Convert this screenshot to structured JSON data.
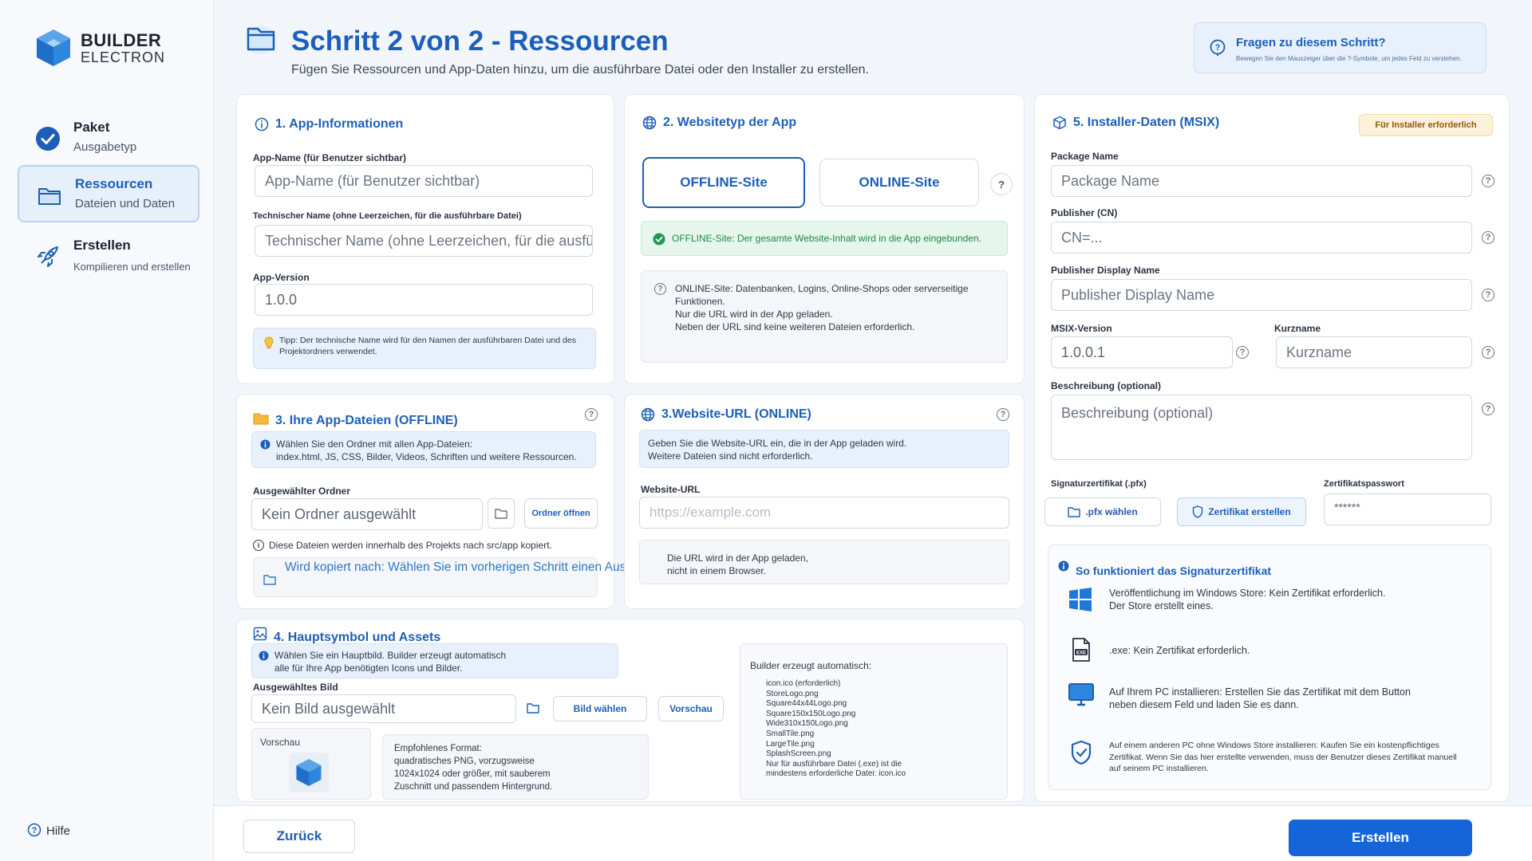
{
  "sidebar": {
    "logo_line1": "BUILDER",
    "logo_line2": "ELECTRON",
    "steps": [
      {
        "title": "Paket",
        "subtitle": "Ausgabetyp",
        "icon": "check-circle-icon",
        "state": "done"
      },
      {
        "title": "Ressourcen",
        "subtitle": "Dateien und Daten",
        "icon": "folder-icon",
        "state": "active"
      },
      {
        "title": "Erstellen",
        "subtitle": "Kompilieren und erstellen",
        "icon": "rocket-icon",
        "state": "pending"
      }
    ],
    "help_label": "Hilfe"
  },
  "header": {
    "title": "Schritt 2 von 2 - Ressourcen",
    "subtitle": "Fügen Sie Ressourcen und App-Daten hinzu, um die ausführbare Datei oder den Installer zu erstellen.",
    "help_title": "Fragen zu diesem Schritt?",
    "help_text": "Bewegen Sie den Mauszeiger über die ?-Symbole, um jedes Feld zu verstehen."
  },
  "app_info": {
    "title": "1. App-Informationen",
    "name_label": "App-Name (für Benutzer sichtbar)",
    "name_placeholder": "App-Name (für Benutzer sichtbar)",
    "tech_label": "Technischer Name (ohne Leerzeichen, für die ausführbare Datei)",
    "tech_placeholder": "Technischer Name (ohne Leerzeichen, für die ausführbare Datei)",
    "version_label": "App-Version",
    "version_value": "1.0.0",
    "tip": "Tipp: Der technische Name wird für den Namen der ausführbaren Datei und des Projektordners verwendet."
  },
  "site_type": {
    "title": "2. Websitetyp der App",
    "offline_label": "OFFLINE-Site",
    "online_label": "ONLINE-Site",
    "help_glyph": "?",
    "offline_note": "OFFLINE-Site: Der gesamte Website-Inhalt wird in die App eingebunden.",
    "online_note_1": "ONLINE-Site: Datenbanken, Logins, Online-Shops oder serverseitige Funktionen.",
    "online_note_2": "Nur die URL wird in der App geladen.",
    "online_note_3": "Neben der URL sind keine weiteren Dateien erforderlich."
  },
  "installer": {
    "title": "5. Installer-Daten (MSIX)",
    "badge": "Für Installer erforderlich",
    "package_label": "Package Name",
    "package_placeholder": "Package Name",
    "publisher_label": "Publisher (CN)",
    "publisher_placeholder": "CN=...",
    "display_label": "Publisher Display Name",
    "display_placeholder": "Publisher Display Name",
    "msix_label": "MSIX-Version",
    "msix_value": "1.0.0.1",
    "short_label": "Kurzname",
    "short_placeholder": "Kurzname",
    "desc_label": "Beschreibung (optional)",
    "desc_placeholder": "Beschreibung (optional)",
    "cert_label": "Signaturzertifikat (.pfx)",
    "pfx_button": ".pfx wählen",
    "create_cert_button": "Zertifikat erstellen",
    "pwd_label": "Zertifikatspasswort",
    "pwd_value": "******"
  },
  "cert_info": {
    "title": "So funktioniert das Signaturzertifikat",
    "items": [
      {
        "icon": "windows-icon",
        "text_1": "Veröffentlichung im Windows Store: Kein Zertifikat erforderlich.",
        "text_2": "Der Store erstellt eines."
      },
      {
        "icon": "exe-file-icon",
        "text_1": ".exe: Kein Zertifikat erforderlich.",
        "text_2": ""
      },
      {
        "icon": "monitor-icon",
        "text_1": "Auf Ihrem PC installieren: Erstellen Sie das Zertifikat mit dem Button",
        "text_2": "neben diesem Feld und laden Sie es dann."
      },
      {
        "icon": "shield-icon",
        "text_1": "Auf einem anderen PC ohne Windows Store installieren: Kaufen Sie ein kostenpflichtiges Zertifikat. Wenn Sie das hier erstellte verwenden, muss der Benutzer dieses Zertifikat manuell auf seinem PC installieren.",
        "text_2": ""
      }
    ]
  },
  "app_files": {
    "title": "3. Ihre App-Dateien (OFFLINE)",
    "info_1": "Wählen Sie den Ordner mit allen App-Dateien:",
    "info_2": "index.html, JS, CSS, Bilder, Videos, Schriften und weitere Ressourcen.",
    "folder_label": "Ausgewählter Ordner",
    "folder_value": "Kein Ordner ausgewählt",
    "open_button": "Ordner öffnen",
    "copy_note": "Diese Dateien werden innerhalb des Projekts nach src/app kopiert.",
    "copy_target": "Wird kopiert nach: Wählen Sie im vorherigen Schritt einen Ausgabeordner"
  },
  "website_url": {
    "title": "3.Website-URL (ONLINE)",
    "info_1": "Geben Sie die Website-URL ein, die in der App geladen wird.",
    "info_2": "Weitere Dateien sind nicht erforderlich.",
    "url_label": "Website-URL",
    "url_placeholder": "https://example.com",
    "note_1": "Die URL wird in der App geladen,",
    "note_2": "nicht in einem Browser."
  },
  "assets": {
    "title": "4. Hauptsymbol und Assets",
    "info_1": "Wählen Sie ein Hauptbild. Builder erzeugt automatisch",
    "info_2": "alle für Ihre App benötigten Icons und Bilder.",
    "image_label": "Ausgewähltes Bild",
    "image_value": "Kein Bild ausgewählt",
    "choose_button": "Bild wählen",
    "preview_button": "Vorschau",
    "preview_label": "Vorschau",
    "format_1": "Empfohlenes Format:",
    "format_2": "quadratisches PNG, vorzugsweise",
    "format_3": "1024x1024 oder größer, mit sauberem",
    "format_4": "Zuschnitt und passendem Hintergrund.",
    "auto_title": "Builder erzeugt automatisch:",
    "auto_list": [
      "icon.ico (erforderlich)",
      "StoreLogo.png",
      "Square44x44Logo.png",
      "Square150x150Logo.png",
      "Wide310x150Logo.png",
      "SmallTile.png",
      "LargeTile.png",
      "SplashScreen.png",
      "Nur für ausführbare Datei (.exe) ist die",
      "mindestens erforderliche Datei: icon.ico"
    ]
  },
  "footer": {
    "back_button": "Zurück",
    "create_button": "Erstellen"
  },
  "colors": {
    "accent": "#1d5fb8",
    "primary_button": "#1565d8",
    "success": "#1e9a4e",
    "badge_bg": "#fdf1dc"
  }
}
